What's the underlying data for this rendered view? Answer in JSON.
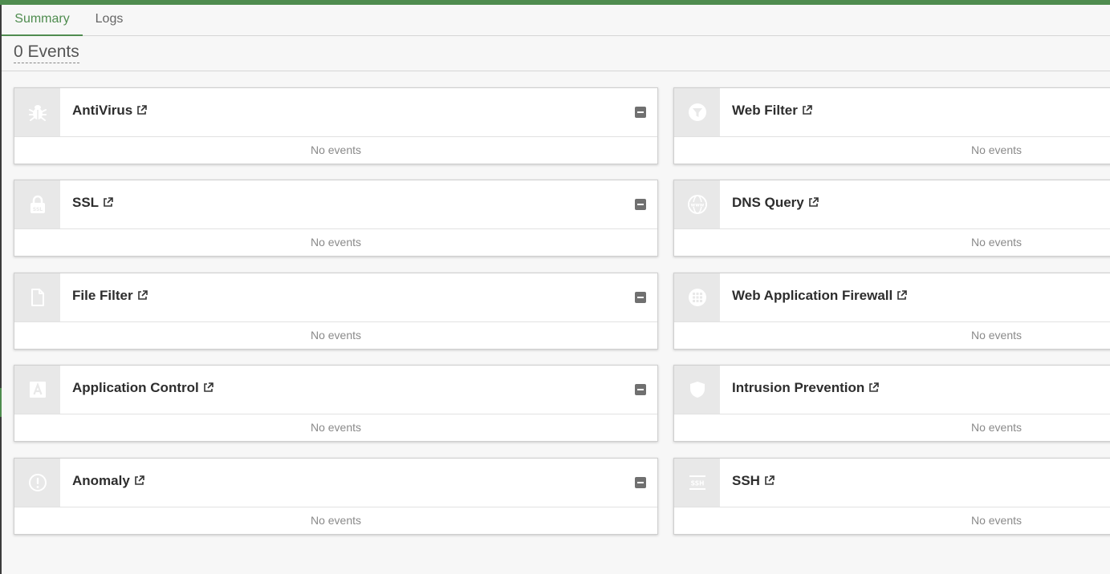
{
  "tabs": [
    {
      "label": "Summary",
      "active": true
    },
    {
      "label": "Logs",
      "active": false
    }
  ],
  "events_title": "0 Events",
  "colors": {
    "accent": "#4f8c4f",
    "icon_bg": "#e8e8e8",
    "icon_fg": "#ffffff"
  },
  "cards": [
    {
      "title": "AntiVirus",
      "icon": "bug-icon",
      "body": "No events",
      "collapsible": true
    },
    {
      "title": "Web Filter",
      "icon": "filter-icon",
      "body": "No events",
      "collapsible": false
    },
    {
      "title": "SSL",
      "icon": "ssl-lock-icon",
      "body": "No events",
      "collapsible": true
    },
    {
      "title": "DNS Query",
      "icon": "www-globe-icon",
      "body": "No events",
      "collapsible": false
    },
    {
      "title": "File Filter",
      "icon": "file-icon",
      "body": "No events",
      "collapsible": true
    },
    {
      "title": "Web Application Firewall",
      "icon": "waf-grid-icon",
      "body": "No events",
      "collapsible": false
    },
    {
      "title": "Application Control",
      "icon": "app-a-icon",
      "body": "No events",
      "collapsible": true
    },
    {
      "title": "Intrusion Prevention",
      "icon": "shield-icon",
      "body": "No events",
      "collapsible": false
    },
    {
      "title": "Anomaly",
      "icon": "exclamation-circle-icon",
      "body": "No events",
      "collapsible": true
    },
    {
      "title": "SSH",
      "icon": "ssh-icon",
      "body": "No events",
      "collapsible": false
    }
  ]
}
